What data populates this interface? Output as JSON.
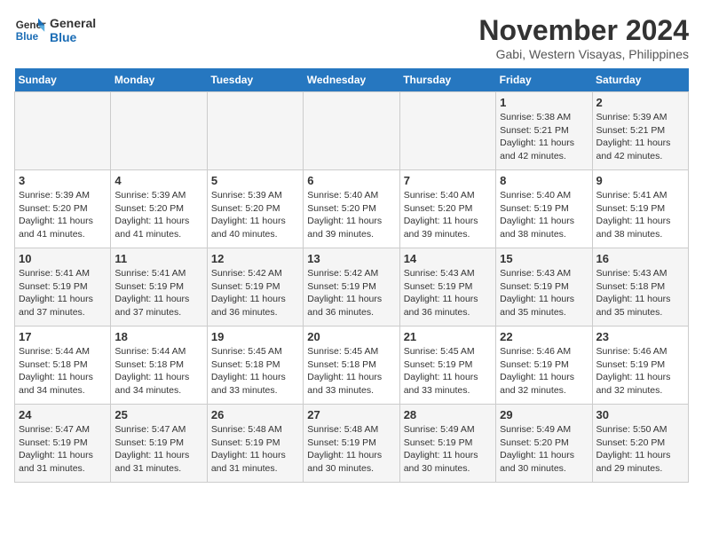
{
  "logo": {
    "line1": "General",
    "line2": "Blue"
  },
  "title": "November 2024",
  "subtitle": "Gabi, Western Visayas, Philippines",
  "days_header": [
    "Sunday",
    "Monday",
    "Tuesday",
    "Wednesday",
    "Thursday",
    "Friday",
    "Saturday"
  ],
  "weeks": [
    [
      {
        "day": "",
        "info": ""
      },
      {
        "day": "",
        "info": ""
      },
      {
        "day": "",
        "info": ""
      },
      {
        "day": "",
        "info": ""
      },
      {
        "day": "",
        "info": ""
      },
      {
        "day": "1",
        "info": "Sunrise: 5:38 AM\nSunset: 5:21 PM\nDaylight: 11 hours and 42 minutes."
      },
      {
        "day": "2",
        "info": "Sunrise: 5:39 AM\nSunset: 5:21 PM\nDaylight: 11 hours and 42 minutes."
      }
    ],
    [
      {
        "day": "3",
        "info": "Sunrise: 5:39 AM\nSunset: 5:20 PM\nDaylight: 11 hours and 41 minutes."
      },
      {
        "day": "4",
        "info": "Sunrise: 5:39 AM\nSunset: 5:20 PM\nDaylight: 11 hours and 41 minutes."
      },
      {
        "day": "5",
        "info": "Sunrise: 5:39 AM\nSunset: 5:20 PM\nDaylight: 11 hours and 40 minutes."
      },
      {
        "day": "6",
        "info": "Sunrise: 5:40 AM\nSunset: 5:20 PM\nDaylight: 11 hours and 39 minutes."
      },
      {
        "day": "7",
        "info": "Sunrise: 5:40 AM\nSunset: 5:20 PM\nDaylight: 11 hours and 39 minutes."
      },
      {
        "day": "8",
        "info": "Sunrise: 5:40 AM\nSunset: 5:19 PM\nDaylight: 11 hours and 38 minutes."
      },
      {
        "day": "9",
        "info": "Sunrise: 5:41 AM\nSunset: 5:19 PM\nDaylight: 11 hours and 38 minutes."
      }
    ],
    [
      {
        "day": "10",
        "info": "Sunrise: 5:41 AM\nSunset: 5:19 PM\nDaylight: 11 hours and 37 minutes."
      },
      {
        "day": "11",
        "info": "Sunrise: 5:41 AM\nSunset: 5:19 PM\nDaylight: 11 hours and 37 minutes."
      },
      {
        "day": "12",
        "info": "Sunrise: 5:42 AM\nSunset: 5:19 PM\nDaylight: 11 hours and 36 minutes."
      },
      {
        "day": "13",
        "info": "Sunrise: 5:42 AM\nSunset: 5:19 PM\nDaylight: 11 hours and 36 minutes."
      },
      {
        "day": "14",
        "info": "Sunrise: 5:43 AM\nSunset: 5:19 PM\nDaylight: 11 hours and 36 minutes."
      },
      {
        "day": "15",
        "info": "Sunrise: 5:43 AM\nSunset: 5:19 PM\nDaylight: 11 hours and 35 minutes."
      },
      {
        "day": "16",
        "info": "Sunrise: 5:43 AM\nSunset: 5:18 PM\nDaylight: 11 hours and 35 minutes."
      }
    ],
    [
      {
        "day": "17",
        "info": "Sunrise: 5:44 AM\nSunset: 5:18 PM\nDaylight: 11 hours and 34 minutes."
      },
      {
        "day": "18",
        "info": "Sunrise: 5:44 AM\nSunset: 5:18 PM\nDaylight: 11 hours and 34 minutes."
      },
      {
        "day": "19",
        "info": "Sunrise: 5:45 AM\nSunset: 5:18 PM\nDaylight: 11 hours and 33 minutes."
      },
      {
        "day": "20",
        "info": "Sunrise: 5:45 AM\nSunset: 5:18 PM\nDaylight: 11 hours and 33 minutes."
      },
      {
        "day": "21",
        "info": "Sunrise: 5:45 AM\nSunset: 5:19 PM\nDaylight: 11 hours and 33 minutes."
      },
      {
        "day": "22",
        "info": "Sunrise: 5:46 AM\nSunset: 5:19 PM\nDaylight: 11 hours and 32 minutes."
      },
      {
        "day": "23",
        "info": "Sunrise: 5:46 AM\nSunset: 5:19 PM\nDaylight: 11 hours and 32 minutes."
      }
    ],
    [
      {
        "day": "24",
        "info": "Sunrise: 5:47 AM\nSunset: 5:19 PM\nDaylight: 11 hours and 31 minutes."
      },
      {
        "day": "25",
        "info": "Sunrise: 5:47 AM\nSunset: 5:19 PM\nDaylight: 11 hours and 31 minutes."
      },
      {
        "day": "26",
        "info": "Sunrise: 5:48 AM\nSunset: 5:19 PM\nDaylight: 11 hours and 31 minutes."
      },
      {
        "day": "27",
        "info": "Sunrise: 5:48 AM\nSunset: 5:19 PM\nDaylight: 11 hours and 30 minutes."
      },
      {
        "day": "28",
        "info": "Sunrise: 5:49 AM\nSunset: 5:19 PM\nDaylight: 11 hours and 30 minutes."
      },
      {
        "day": "29",
        "info": "Sunrise: 5:49 AM\nSunset: 5:20 PM\nDaylight: 11 hours and 30 minutes."
      },
      {
        "day": "30",
        "info": "Sunrise: 5:50 AM\nSunset: 5:20 PM\nDaylight: 11 hours and 29 minutes."
      }
    ]
  ]
}
